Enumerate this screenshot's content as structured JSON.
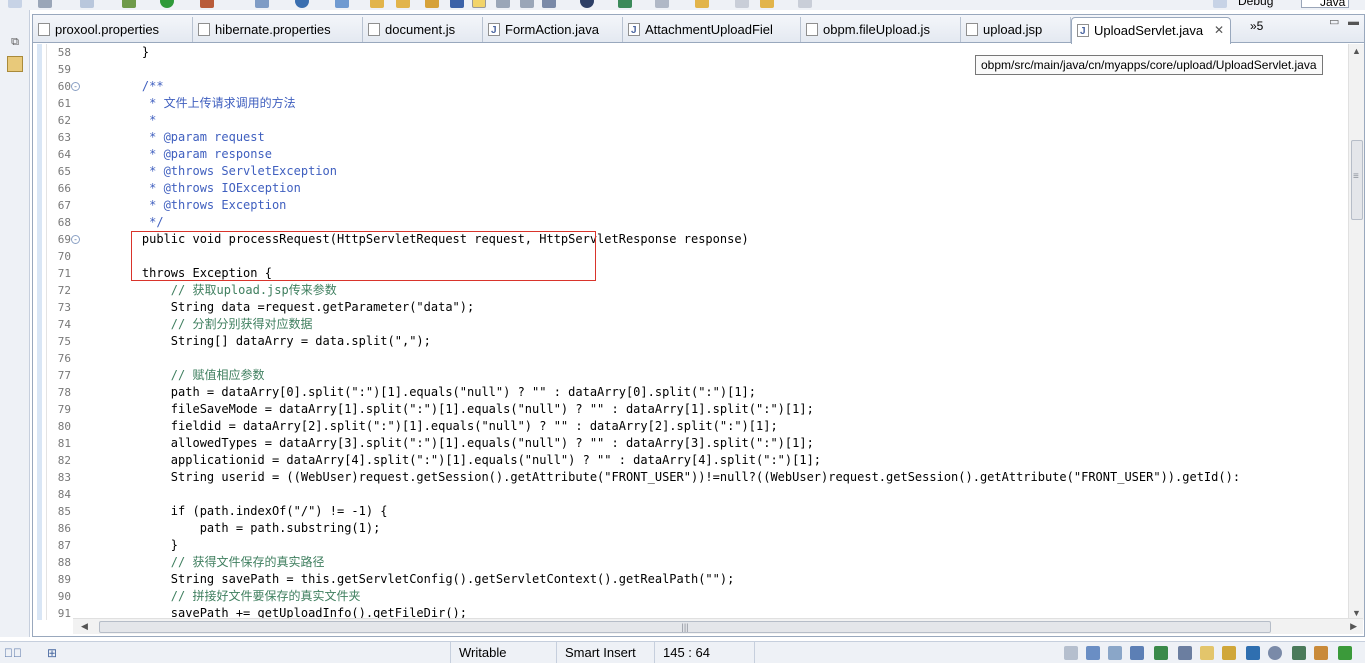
{
  "perspectives": {
    "debug": "Debug",
    "java": "Java"
  },
  "tabs": [
    {
      "label": "proxool.properties",
      "type": "file"
    },
    {
      "label": "hibernate.properties",
      "type": "file"
    },
    {
      "label": "document.js",
      "type": "file"
    },
    {
      "label": "FormAction.java",
      "type": "java"
    },
    {
      "label": "AttachmentUploadFiel",
      "type": "java"
    },
    {
      "label": "obpm.fileUpload.js",
      "type": "file"
    },
    {
      "label": "upload.jsp",
      "type": "file"
    },
    {
      "label": "UploadServlet.java",
      "type": "java",
      "active": true,
      "close": "✕"
    }
  ],
  "tab_overflow": "»5",
  "tooltip": "obpm/src/main/java/cn/myapps/core/upload/UploadServlet.java",
  "code_lines": [
    {
      "n": "58",
      "text": "    }",
      "cls": ""
    },
    {
      "n": "59",
      "text": "",
      "cls": ""
    },
    {
      "n": "60",
      "text": "    /**",
      "cls": "c",
      "fold": "-"
    },
    {
      "n": "61",
      "text": "     * 文件上传请求调用的方法",
      "cls": "c"
    },
    {
      "n": "62",
      "text": "     *",
      "cls": "c"
    },
    {
      "n": "63",
      "text": "     * @param request",
      "cls": "c"
    },
    {
      "n": "64",
      "text": "     * @param response",
      "cls": "c"
    },
    {
      "n": "65",
      "text": "     * @throws ServletException",
      "cls": "c"
    },
    {
      "n": "66",
      "text": "     * @throws IOException",
      "cls": "c"
    },
    {
      "n": "67",
      "text": "     * @throws Exception",
      "cls": "c"
    },
    {
      "n": "68",
      "text": "     */",
      "cls": "c"
    },
    {
      "n": "69",
      "text": "    public void processRequest(HttpServletRequest request, HttpServletResponse response)",
      "cls": "",
      "fold": "-"
    },
    {
      "n": "70",
      "text": "",
      "cls": ""
    },
    {
      "n": "71",
      "text": "    throws Exception {",
      "cls": ""
    },
    {
      "n": "72",
      "text": "        // 获取upload.jsp传来参数",
      "cls": "g"
    },
    {
      "n": "73",
      "text": "        String data =request.getParameter(\"data\");",
      "cls": ""
    },
    {
      "n": "74",
      "text": "        // 分割分别获得对应数据",
      "cls": "g"
    },
    {
      "n": "75",
      "text": "        String[] dataArry = data.split(\",\");",
      "cls": ""
    },
    {
      "n": "76",
      "text": "",
      "cls": ""
    },
    {
      "n": "77",
      "text": "        // 赋值相应参数",
      "cls": "g"
    },
    {
      "n": "78",
      "text": "        path = dataArry[0].split(\":\")[1].equals(\"null\") ? \"\" : dataArry[0].split(\":\")[1];",
      "cls": ""
    },
    {
      "n": "79",
      "text": "        fileSaveMode = dataArry[1].split(\":\")[1].equals(\"null\") ? \"\" : dataArry[1].split(\":\")[1];",
      "cls": ""
    },
    {
      "n": "80",
      "text": "        fieldid = dataArry[2].split(\":\")[1].equals(\"null\") ? \"\" : dataArry[2].split(\":\")[1];",
      "cls": ""
    },
    {
      "n": "81",
      "text": "        allowedTypes = dataArry[3].split(\":\")[1].equals(\"null\") ? \"\" : dataArry[3].split(\":\")[1];",
      "cls": ""
    },
    {
      "n": "82",
      "text": "        applicationid = dataArry[4].split(\":\")[1].equals(\"null\") ? \"\" : dataArry[4].split(\":\")[1];",
      "cls": ""
    },
    {
      "n": "83",
      "text": "        String userid = ((WebUser)request.getSession().getAttribute(\"FRONT_USER\"))!=null?((WebUser)request.getSession().getAttribute(\"FRONT_USER\")).getId():",
      "cls": ""
    },
    {
      "n": "84",
      "text": "",
      "cls": ""
    },
    {
      "n": "85",
      "text": "        if (path.indexOf(\"/\") != -1) {",
      "cls": ""
    },
    {
      "n": "86",
      "text": "            path = path.substring(1);",
      "cls": ""
    },
    {
      "n": "87",
      "text": "        }",
      "cls": ""
    },
    {
      "n": "88",
      "text": "        // 获得文件保存的真实路径",
      "cls": "g"
    },
    {
      "n": "89",
      "text": "        String savePath = this.getServletConfig().getServletContext().getRealPath(\"\");",
      "cls": ""
    },
    {
      "n": "90",
      "text": "        // 拼接好文件要保存的真实文件夹",
      "cls": "g"
    },
    {
      "n": "91",
      "text": "        savePath += getUploadInfo().getFileDir();",
      "cls": ""
    }
  ],
  "statusbar": {
    "mode": "Writable",
    "insert": "Smart Insert",
    "position": "145 : 64"
  }
}
